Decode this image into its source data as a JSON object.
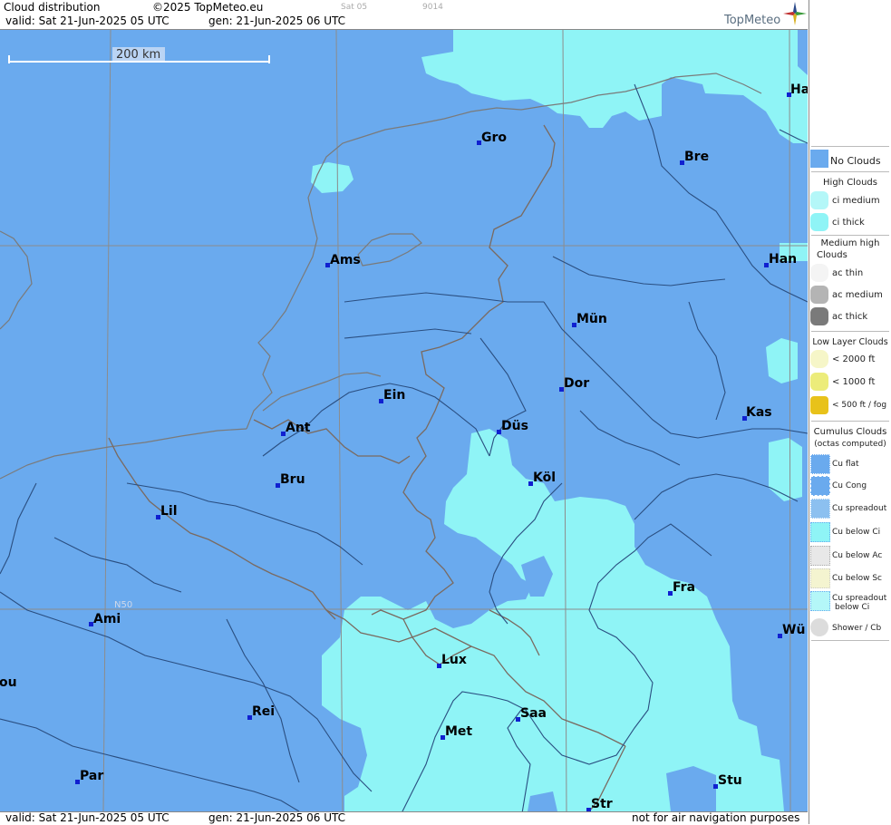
{
  "header": {
    "product": "Cloud distribution",
    "copyright": "©2025 TopMeteo.eu",
    "valid": "valid:  Sat  21-Jun-2025  05 UTC",
    "gen": "gen: 21-Jun-2025 06 UTC",
    "tiny_a": "Sat 05",
    "tiny_b": "9014",
    "logo": "TopMeteo"
  },
  "footer": {
    "valid": "valid:  Sat  21-Jun-2025  05 UTC",
    "gen": "gen: 21-Jun-2025 06 UTC",
    "note": "not for air navigation purposes"
  },
  "map": {
    "scale_label": "200 km",
    "lat_label": "N50",
    "colors": {
      "no_clouds": "#6aaaee",
      "ci_thick": "#8ff4f6",
      "grid": "#8c8c8c",
      "border": "#7a6a60",
      "river": "#2a4e80"
    },
    "cities": [
      {
        "name": "Ha"
      },
      {
        "name": "Gro"
      },
      {
        "name": "Bre"
      },
      {
        "name": "Ams"
      },
      {
        "name": "Han"
      },
      {
        "name": "Mün"
      },
      {
        "name": "Ein"
      },
      {
        "name": "Dor"
      },
      {
        "name": "Kas"
      },
      {
        "name": "Ant"
      },
      {
        "name": "Düs"
      },
      {
        "name": "Bru"
      },
      {
        "name": "Köl"
      },
      {
        "name": "Lil"
      },
      {
        "name": "Fra"
      },
      {
        "name": "Ami"
      },
      {
        "name": "Wü"
      },
      {
        "name": "Lux"
      },
      {
        "name": "ou"
      },
      {
        "name": "Rei"
      },
      {
        "name": "Saa"
      },
      {
        "name": "Met"
      },
      {
        "name": "Par"
      },
      {
        "name": "Stu"
      },
      {
        "name": "Str"
      }
    ]
  },
  "legend": {
    "no_clouds": "No Clouds",
    "high_title": "High Clouds",
    "ci_medium": "ci medium",
    "ci_thick": "ci thick",
    "medium_title_1": "Medium high",
    "medium_title_2": "Clouds",
    "ac_thin": "ac thin",
    "ac_medium": "ac medium",
    "ac_thick": "ac thick",
    "low_title": "Low Layer Clouds",
    "low_2000": "< 2000 ft",
    "low_1000": "< 1000 ft",
    "low_500": "< 500 ft / fog",
    "cu_title": "Cumulus Clouds",
    "cu_sub": "(octas computed)",
    "cu_flat": "Cu flat",
    "cu_cong": "Cu Cong",
    "cu_spread": "Cu spreadout",
    "cu_below_ci": "Cu below Ci",
    "cu_below_ac": "Cu below Ac",
    "cu_below_sc": "Cu below Sc",
    "cu_spread_ci_1": "Cu spreadout",
    "cu_spread_ci_2": "below Ci",
    "shower": "Shower / Cb"
  }
}
